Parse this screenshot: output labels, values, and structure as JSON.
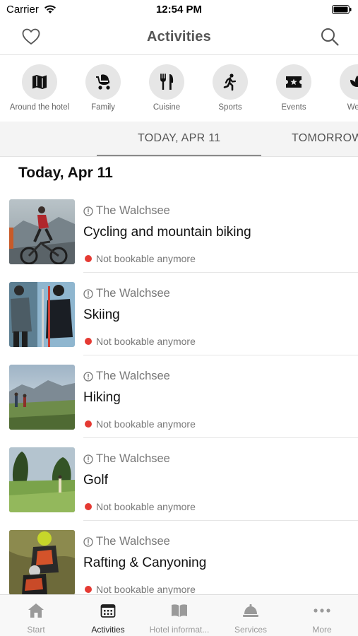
{
  "status_bar": {
    "carrier": "Carrier",
    "time": "12:54 PM"
  },
  "header": {
    "title": "Activities",
    "left_icon": "heart-icon",
    "right_icon": "search-icon"
  },
  "categories": [
    {
      "label": "Around the hotel",
      "icon": "map-icon"
    },
    {
      "label": "Family",
      "icon": "stroller-icon"
    },
    {
      "label": "Cuisine",
      "icon": "cutlery-icon"
    },
    {
      "label": "Sports",
      "icon": "running-icon"
    },
    {
      "label": "Events",
      "icon": "ticket-icon"
    },
    {
      "label": "Welln",
      "icon": "lotus-icon"
    }
  ],
  "day_tabs": [
    {
      "label": "TODAY, APR 11",
      "selected": true
    },
    {
      "label": "TOMORROW",
      "selected": false
    }
  ],
  "section_title": "Today, Apr 11",
  "activities": [
    {
      "location": "The Walchsee",
      "name": "Cycling and mountain biking",
      "status": "Not bookable anymore"
    },
    {
      "location": "The Walchsee",
      "name": "Skiing",
      "status": "Not bookable anymore"
    },
    {
      "location": "The Walchsee",
      "name": "Hiking",
      "status": "Not bookable anymore"
    },
    {
      "location": "The Walchsee",
      "name": "Golf",
      "status": "Not bookable anymore"
    },
    {
      "location": "The Walchsee",
      "name": "Rafting & Canyoning",
      "status": "Not bookable anymore"
    }
  ],
  "tab_bar": [
    {
      "label": "Start",
      "icon": "home-icon",
      "active": false
    },
    {
      "label": "Activities",
      "icon": "calendar-icon",
      "active": true
    },
    {
      "label": "Hotel informat...",
      "icon": "book-icon",
      "active": false
    },
    {
      "label": "Services",
      "icon": "bell-icon",
      "active": false
    },
    {
      "label": "More",
      "icon": "more-icon",
      "active": false
    }
  ],
  "colors": {
    "status_dot": "#e53a33",
    "category_circle": "#e6e6e6",
    "tab_active": "#222222",
    "tab_inactive": "#9a9a9a"
  }
}
